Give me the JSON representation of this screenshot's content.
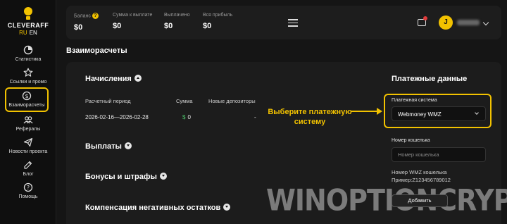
{
  "brand": {
    "name": "CLEVERAFF",
    "lang_ru": "RU",
    "lang_en": "EN",
    "accent": "#f2c200"
  },
  "sidebar": {
    "items": [
      {
        "label": "Статистика",
        "icon": "pie-chart-icon"
      },
      {
        "label": "Ссылки и промо",
        "icon": "star-icon"
      },
      {
        "label": "Взаиморасчеты",
        "icon": "dollar-circle-icon",
        "active": true
      },
      {
        "label": "Рефералы",
        "icon": "users-icon"
      },
      {
        "label": "Новости проекта",
        "icon": "send-icon"
      },
      {
        "label": "Блог",
        "icon": "blog-icon"
      },
      {
        "label": "Помощь",
        "icon": "help-icon"
      }
    ]
  },
  "topbar": {
    "stats": [
      {
        "label": "Баланс",
        "value": "$0"
      },
      {
        "label": "Сумма к выплате",
        "value": "$0"
      },
      {
        "label": "Выплачено",
        "value": "$0"
      },
      {
        "label": "Вся прибыль",
        "value": "$0"
      }
    ],
    "help_mark": "?",
    "avatar_letter": "J"
  },
  "page": {
    "title": "Взаиморасчеты"
  },
  "accruals": {
    "title": "Начисления",
    "columns": [
      "Расчетный период",
      "Сумма",
      "Новые депозиторы"
    ],
    "row": {
      "period": "2026-02-16—2026-02-28",
      "currency": "$",
      "amount": "0",
      "depositors": "-"
    }
  },
  "sections": {
    "payouts": "Выплаты",
    "bonuses": "Бонусы и штрафы",
    "compensation": "Компенсация негативных остатков"
  },
  "annotation": {
    "line1": "Выберите платежную",
    "line2": "систему"
  },
  "payment": {
    "title": "Платежные данные",
    "system_label": "Платежная система",
    "system_value": "Webmoney WMZ",
    "wallet_label": "Номер кошелька",
    "wallet_placeholder": "Номер кошелька",
    "hint_line1": "Номер WMZ кошелька",
    "hint_line2": "Пример:Z123456789012",
    "add_button": "Добавить"
  },
  "watermark": "WINOPTIONCRYPTO.COM"
}
